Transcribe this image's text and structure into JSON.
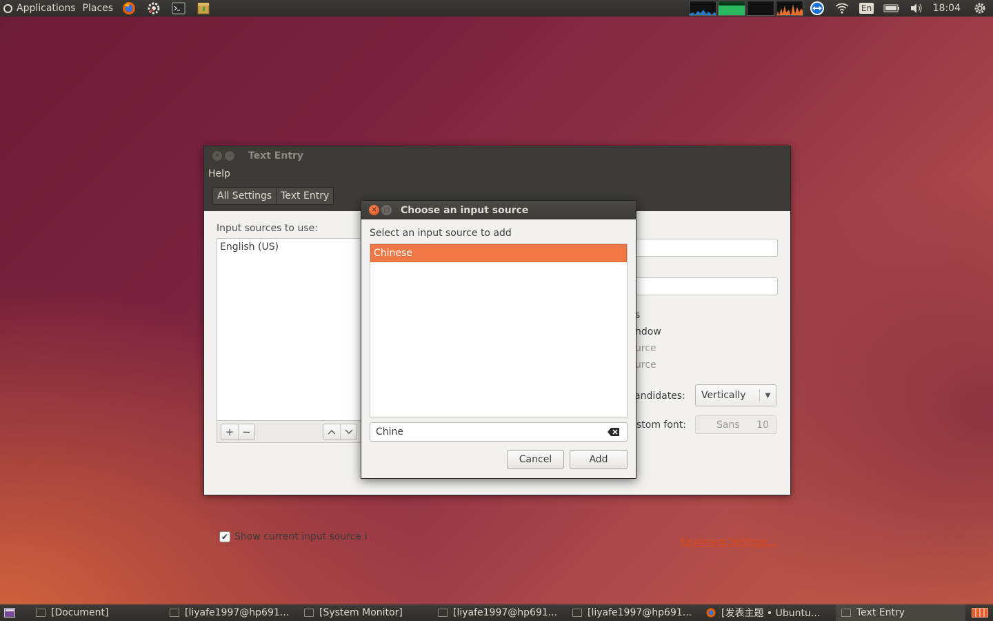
{
  "top_panel": {
    "applications_label": "Applications",
    "places_label": "Places",
    "launchers": [
      "firefox-icon",
      "settings-icon",
      "terminal-icon",
      "archive-icon"
    ],
    "keyboard_layout": "En",
    "clock": "18:04"
  },
  "window": {
    "title": "Text Entry",
    "menu_help": "Help",
    "breadcrumbs": [
      "All Settings",
      "Text Entry"
    ],
    "input_sources_label": "Input sources to use:",
    "input_sources": [
      "English (US)"
    ],
    "partial_labels": [
      "s",
      "ndow",
      "urce",
      "urce"
    ],
    "candidates_label_partial": "andidates:",
    "candidates_value": "Vertically",
    "custom_font_label_partial": "stom font:",
    "font_name": "Sans",
    "font_size": "10",
    "show_checkbox_label": "Show current input source i",
    "keyboard_settings_link": "Keyboard Settings..."
  },
  "dialog": {
    "title": "Choose an input source",
    "prompt": "Select an input source to add",
    "results": [
      "Chinese"
    ],
    "search_value": "Chine",
    "cancel_label": "Cancel",
    "add_label": "Add"
  },
  "taskbar": {
    "tasks": [
      {
        "label": "[Document]"
      },
      {
        "label": "[liyafe1997@hp691..."
      },
      {
        "label": "[System Monitor]"
      },
      {
        "label": "[liyafe1997@hp691..."
      },
      {
        "label": "[liyafe1997@hp691..."
      },
      {
        "label": "[发表主题 • Ubuntu..."
      },
      {
        "label": "Text Entry"
      }
    ]
  },
  "colors": {
    "accent": "#f07746",
    "link": "#dd4814",
    "panel": "#3c3b37"
  }
}
